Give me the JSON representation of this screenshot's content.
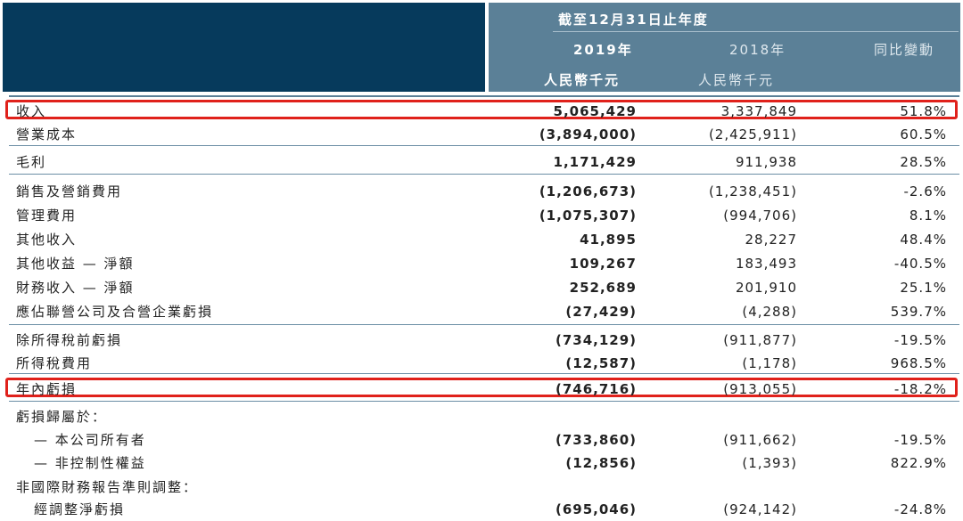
{
  "header": {
    "period": "截至12月31日止年度",
    "year_2019": "2019年",
    "year_2018": "2018年",
    "yoy": "同比變動",
    "unit_2019": "人民幣千元",
    "unit_2018": "人民幣千元"
  },
  "rows": [
    {
      "label": "收入",
      "v2019": "5,065,429",
      "v2018": "3,337,849",
      "pct": "51.8%"
    },
    {
      "label": "營業成本",
      "v2019": "(3,894,000)",
      "v2018": "(2,425,911)",
      "pct": "60.5%"
    },
    {
      "label": "毛利",
      "v2019": "1,171,429",
      "v2018": "911,938",
      "pct": "28.5%"
    },
    {
      "label": "銷售及營銷費用",
      "v2019": "(1,206,673)",
      "v2018": "(1,238,451)",
      "pct": "-2.6%"
    },
    {
      "label": "管理費用",
      "v2019": "(1,075,307)",
      "v2018": "(994,706)",
      "pct": "8.1%"
    },
    {
      "label": "其他收入",
      "v2019": "41,895",
      "v2018": "28,227",
      "pct": "48.4%"
    },
    {
      "label": "其他收益 — 淨額",
      "v2019": "109,267",
      "v2018": "183,493",
      "pct": "-40.5%"
    },
    {
      "label": "財務收入 — 淨額",
      "v2019": "252,689",
      "v2018": "201,910",
      "pct": "25.1%"
    },
    {
      "label": "應佔聯營公司及合營企業虧損",
      "v2019": "(27,429)",
      "v2018": "(4,288)",
      "pct": "539.7%"
    },
    {
      "label": "除所得稅前虧損",
      "v2019": "(734,129)",
      "v2018": "(911,877)",
      "pct": "-19.5%"
    },
    {
      "label": "所得稅費用",
      "v2019": "(12,587)",
      "v2018": "(1,178)",
      "pct": "968.5%"
    },
    {
      "label": "年內虧損",
      "v2019": "(746,716)",
      "v2018": "(913,055)",
      "pct": "-18.2%"
    },
    {
      "label": "虧損歸屬於：",
      "v2019": "",
      "v2018": "",
      "pct": ""
    },
    {
      "label": "— 本公司所有者",
      "v2019": "(733,860)",
      "v2018": "(911,662)",
      "pct": "-19.5%"
    },
    {
      "label": "— 非控制性權益",
      "v2019": "(12,856)",
      "v2018": "(1,393)",
      "pct": "822.9%"
    },
    {
      "label": "非國際財務報告準則調整：",
      "v2019": "",
      "v2018": "",
      "pct": ""
    },
    {
      "label": "經調整淨虧損",
      "v2019": "(695,046)",
      "v2018": "(924,142)",
      "pct": "-24.8%"
    }
  ],
  "highlight_color": "#e0211b"
}
